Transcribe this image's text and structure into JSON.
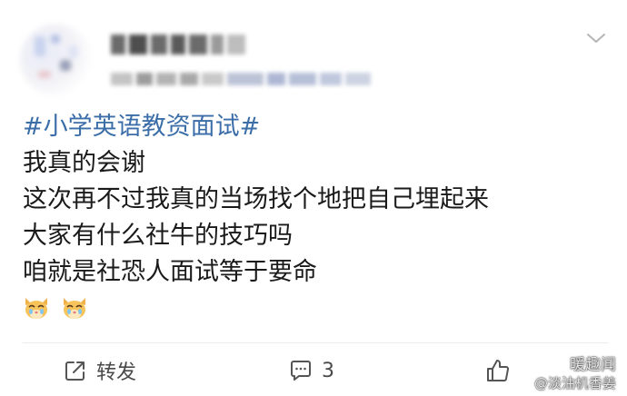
{
  "post": {
    "hashtag": "#小学英语教资面试#",
    "lines": [
      "我真的会谢",
      "这次再不过我真的当场找个地把自己埋起来",
      "大家有什么社牛的技巧吗",
      "咱就是社恐人面试等于要命"
    ],
    "emojis": [
      "crying-cat-emoji",
      "crying-cat-emoji"
    ]
  },
  "footer": {
    "repost_label": "转发",
    "comment_count": "3"
  },
  "watermark": {
    "line1": "暖趣闻",
    "line2": "@淡油机香姜"
  },
  "icons": {
    "more": "chevron-down-icon",
    "repost": "repost-icon",
    "comment": "comment-icon",
    "like": "thumbs-up-icon"
  },
  "colors": {
    "hashtag": "#3b6ea8",
    "text": "#1a1a1a",
    "footer_text": "#4a4a4a"
  }
}
